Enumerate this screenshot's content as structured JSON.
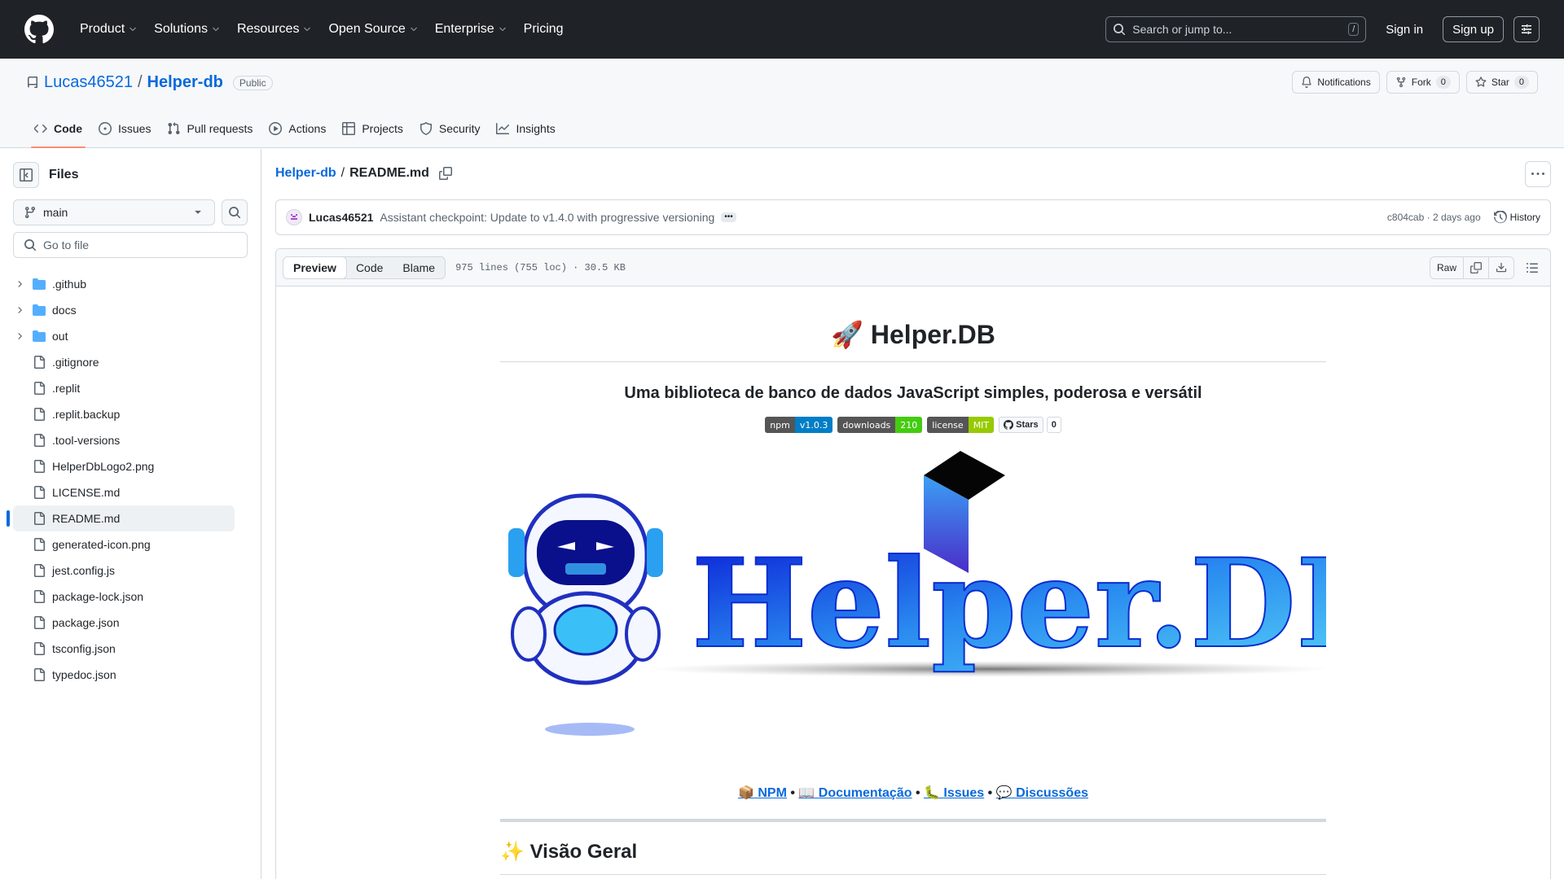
{
  "header": {
    "nav": [
      {
        "label": "Product",
        "has_menu": true
      },
      {
        "label": "Solutions",
        "has_menu": true
      },
      {
        "label": "Resources",
        "has_menu": true
      },
      {
        "label": "Open Source",
        "has_menu": true
      },
      {
        "label": "Enterprise",
        "has_menu": true
      },
      {
        "label": "Pricing",
        "has_menu": false
      }
    ],
    "search_placeholder": "Search or jump to...",
    "search_shortcut": "/",
    "sign_in": "Sign in",
    "sign_up": "Sign up"
  },
  "repo": {
    "owner": "Lucas46521",
    "separator": "/",
    "name": "Helper-db",
    "visibility": "Public",
    "notifications_label": "Notifications",
    "fork_label": "Fork",
    "fork_count": "0",
    "star_label": "Star",
    "star_count": "0",
    "tabs": [
      {
        "label": "Code",
        "icon": "code-icon",
        "active": true
      },
      {
        "label": "Issues",
        "icon": "issue-icon",
        "active": false
      },
      {
        "label": "Pull requests",
        "icon": "pull-request-icon",
        "active": false
      },
      {
        "label": "Actions",
        "icon": "play-icon",
        "active": false
      },
      {
        "label": "Projects",
        "icon": "table-icon",
        "active": false
      },
      {
        "label": "Security",
        "icon": "shield-icon",
        "active": false
      },
      {
        "label": "Insights",
        "icon": "graph-icon",
        "active": false
      }
    ]
  },
  "sidebar": {
    "title": "Files",
    "branch": "main",
    "goto_placeholder": "Go to file",
    "tree": [
      {
        "name": ".github",
        "type": "folder"
      },
      {
        "name": "docs",
        "type": "folder"
      },
      {
        "name": "out",
        "type": "folder"
      },
      {
        "name": ".gitignore",
        "type": "file"
      },
      {
        "name": ".replit",
        "type": "file"
      },
      {
        "name": ".replit.backup",
        "type": "file"
      },
      {
        "name": ".tool-versions",
        "type": "file"
      },
      {
        "name": "HelperDbLogo2.png",
        "type": "file"
      },
      {
        "name": "LICENSE.md",
        "type": "file"
      },
      {
        "name": "README.md",
        "type": "file",
        "active": true
      },
      {
        "name": "generated-icon.png",
        "type": "file"
      },
      {
        "name": "jest.config.js",
        "type": "file"
      },
      {
        "name": "package-lock.json",
        "type": "file"
      },
      {
        "name": "package.json",
        "type": "file"
      },
      {
        "name": "tsconfig.json",
        "type": "file"
      },
      {
        "name": "typedoc.json",
        "type": "file"
      }
    ]
  },
  "main": {
    "breadcrumb_repo": "Helper-db",
    "breadcrumb_sep": "/",
    "breadcrumb_file": "README.md",
    "commit": {
      "author": "Lucas46521",
      "message": "Assistant checkpoint: Update to v1.4.0 with progressive versioning",
      "ellipsis": "•••",
      "hash": "c804cab",
      "age": "· 2 days ago",
      "history_label": "History"
    },
    "toolbar": {
      "tabs": [
        "Preview",
        "Code",
        "Blame"
      ],
      "active_tab": "Preview",
      "stats": "975 lines (755 loc) · 30.5 KB",
      "raw_label": "Raw"
    }
  },
  "readme": {
    "title_emoji": "🚀",
    "title": "Helper.DB",
    "tagline": "Uma biblioteca de banco de dados JavaScript simples, poderosa e versátil",
    "badges": [
      {
        "left": "npm",
        "right": "v1.0.3",
        "color": "#007ec6"
      },
      {
        "left": "downloads",
        "right": "210",
        "color": "#4c1"
      },
      {
        "left": "license",
        "right": "MIT",
        "color": "#97ca00"
      }
    ],
    "stars_badge": {
      "label": "Stars",
      "count": "0"
    },
    "logo_text": "Helper.DB",
    "links": [
      {
        "emoji": "📦",
        "label": "NPM"
      },
      {
        "emoji": "📖",
        "label": "Documentação"
      },
      {
        "emoji": "🐛",
        "label": "Issues"
      },
      {
        "emoji": "💬",
        "label": "Discussões"
      }
    ],
    "link_separator": " • ",
    "section_emoji": "✨",
    "section_title": "Visão Geral"
  },
  "colors": {
    "header_bg": "#1f2328",
    "link": "#0969da",
    "active_tab_underline": "#fd8c73",
    "folder": "#54aeff"
  }
}
